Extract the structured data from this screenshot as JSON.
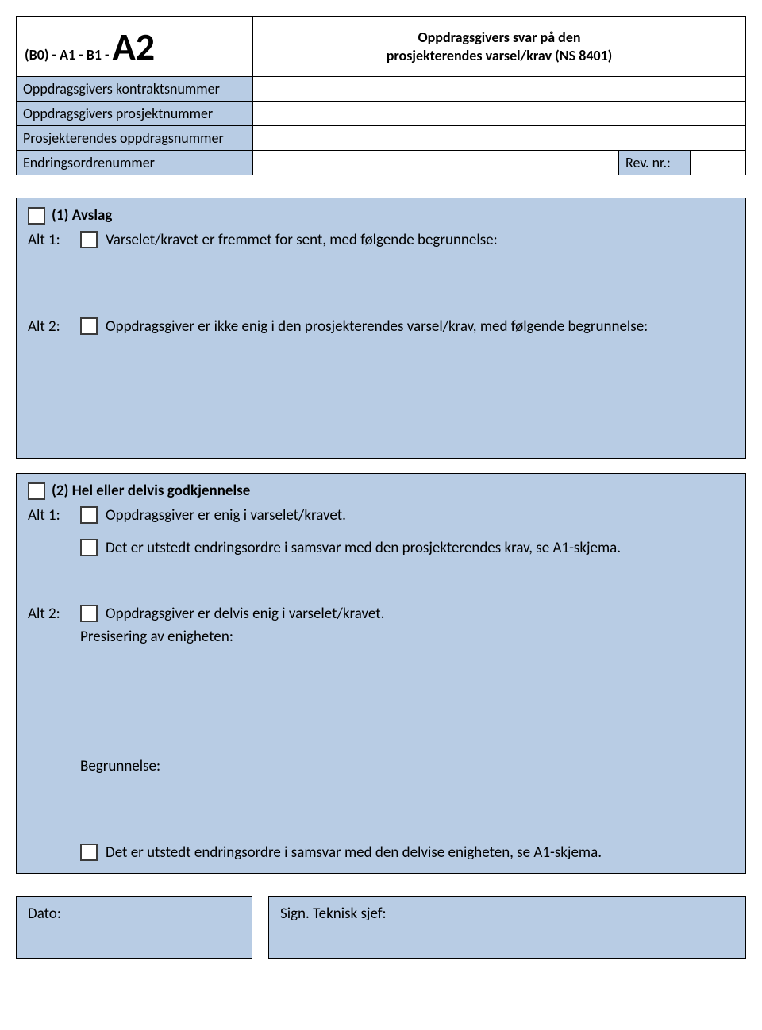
{
  "header": {
    "form_code_prefix": "(B0) - A1 - B1 - ",
    "form_code_main": "A2",
    "title_line1": "Oppdragsgivers svar på den",
    "title_line2": "prosjekterendes varsel/krav (NS 8401)",
    "rows": {
      "contract_no_label": "Oppdragsgivers kontraktsnummer",
      "contract_no_value": "",
      "project_no_label": "Oppdragsgivers prosjektnummer",
      "project_no_value": "",
      "assignment_no_label": "Prosjekterendes oppdragsnummer",
      "assignment_no_value": "",
      "change_order_label": "Endringsordrenummer",
      "change_order_value": "",
      "rev_label": "Rev. nr.:",
      "rev_value": ""
    }
  },
  "section1": {
    "title": "(1) Avslag",
    "alt1_prefix": "Alt 1:",
    "alt1_text": "Varselet/kravet er fremmet for sent, med følgende begrunnelse:",
    "alt2_prefix": "Alt 2:",
    "alt2_text": "Oppdragsgiver er ikke enig i den prosjekterendes varsel/krav, med følgende begrunnelse:"
  },
  "section2": {
    "title": "(2) Hel eller delvis godkjennelse",
    "alt1_prefix": "Alt 1:",
    "alt1_text": "Oppdragsgiver er enig i varselet/kravet.",
    "alt1_sub_text": "Det er utstedt endringsordre i samsvar med den prosjekterendes krav, se A1-skjema.",
    "alt2_prefix": "Alt 2:",
    "alt2_text": "Oppdragsgiver er delvis enig i varselet/kravet.",
    "alt2_sub1": "Presisering av enigheten:",
    "alt2_sub2": "Begrunnelse:",
    "alt2_footer": "Det er utstedt endringsordre i samsvar med den delvise enigheten, se A1-skjema."
  },
  "footer": {
    "date_label": "Dato:",
    "date_value": "",
    "sign_label": "Sign. Teknisk sjef:",
    "sign_value": ""
  }
}
